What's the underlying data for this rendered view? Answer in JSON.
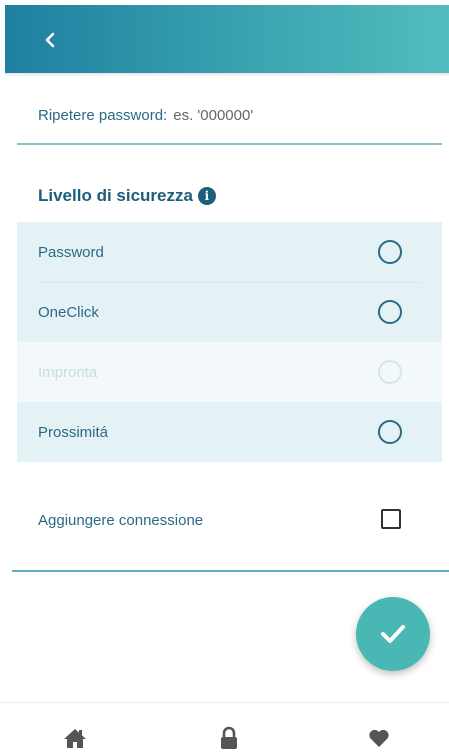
{
  "header": {
    "back_icon": "chevron-left-icon"
  },
  "password": {
    "label": "Ripetere password:",
    "placeholder": "es. '000000'"
  },
  "security": {
    "title": "Livello di sicurezza",
    "info_icon": "info-icon",
    "options": [
      {
        "label": "Password",
        "selected": false,
        "disabled": false
      },
      {
        "label": "OneClick",
        "selected": false,
        "disabled": false
      },
      {
        "label": "Impronta",
        "selected": false,
        "disabled": true
      },
      {
        "label": "Prossimitá",
        "selected": false,
        "disabled": false
      }
    ]
  },
  "connection": {
    "label": "Aggiungere connessione",
    "checked": false
  },
  "fab": {
    "icon": "checkmark-icon"
  },
  "nav": {
    "items": [
      {
        "icon": "home-icon"
      },
      {
        "icon": "lock-icon"
      },
      {
        "icon": "heart-icon"
      }
    ]
  },
  "colors": {
    "header_start": "#1f7fa0",
    "header_end": "#52bdbf",
    "primary_text": "#1f5e7a",
    "option_bg": "#e5f2f5",
    "fab": "#49b8b4"
  }
}
